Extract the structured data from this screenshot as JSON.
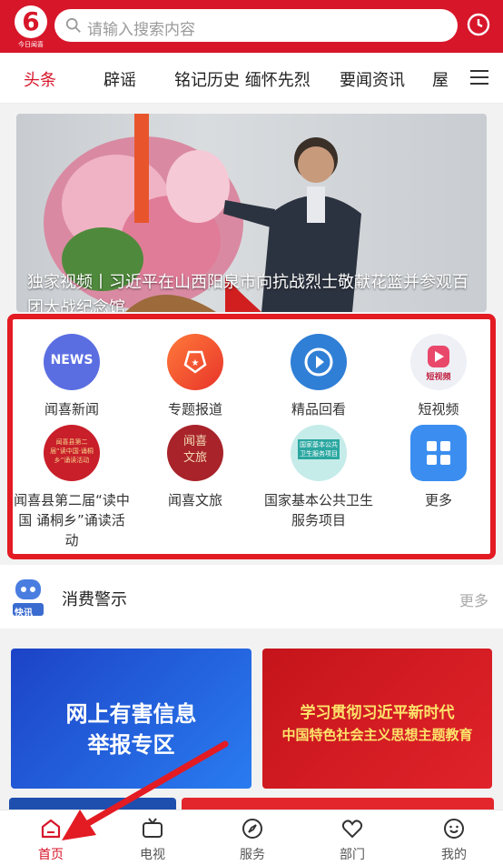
{
  "header": {
    "logo_text": "今日闻喜",
    "search_placeholder": "请输入搜索内容"
  },
  "tabs": [
    {
      "label": "头条",
      "active": true
    },
    {
      "label": "辟谣"
    },
    {
      "label": "铭记历史 缅怀先烈"
    },
    {
      "label": "要闻资讯"
    },
    {
      "label": "屋"
    }
  ],
  "banner": {
    "caption": "独家视频丨习近平在山西阳泉市向抗战烈士敬献花篮并参观百团大战纪念馆"
  },
  "grid": [
    {
      "label": "闻喜新闻",
      "badge": "NEWS",
      "color": "#5b6ee1"
    },
    {
      "label": "专题报道",
      "color": "#f25a2c"
    },
    {
      "label": "精品回看",
      "color": "#2f7fd6"
    },
    {
      "label": "短视频",
      "badge": "短视频",
      "color": "#e9486a"
    },
    {
      "label": "闻喜县第二届“读中国 诵桐乡”诵读活动",
      "badge": "闻喜县第二届“读中国·诵桐乡”诵读活动",
      "color": "#c81f2a"
    },
    {
      "label": "闻喜文旅",
      "badge": "闻喜文旅",
      "color": "#a8232a"
    },
    {
      "label": "国家基本公共卫生服务项目",
      "badge": "国家基本公共卫生服务项目",
      "color": "#2aa7a0"
    },
    {
      "label": "更多",
      "color": "#3b8ef0"
    }
  ],
  "alert": {
    "robot_label": "快讯",
    "text": "消费警示",
    "more": "更多"
  },
  "cards": [
    {
      "line1": "网上有害信息",
      "line2": "举报专区"
    },
    {
      "line1": "学习贯彻习近平新时代",
      "line2": "中国特色社会主义思想主题教育"
    }
  ],
  "bottom_nav": [
    {
      "label": "首页",
      "active": true
    },
    {
      "label": "电视"
    },
    {
      "label": "服务"
    },
    {
      "label": "部门"
    },
    {
      "label": "我的"
    }
  ],
  "colors": {
    "brand": "#d7162a",
    "highlight": "#e31b23"
  }
}
